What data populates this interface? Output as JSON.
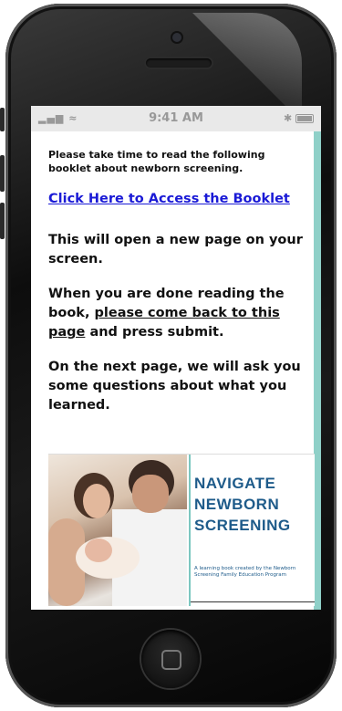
{
  "status_bar": {
    "signal": "▂▄▆",
    "time": "9:41 AM",
    "bluetooth": "✱"
  },
  "page": {
    "intro": "Please take time to read the following booklet about newborn screening.",
    "link_text": "Click Here to Access the Booklet",
    "para1": "This will open a new page on your screen.",
    "para2_prefix": "When you are done reading the book, ",
    "para2_link": "please come back to this page",
    "para2_suffix": " and press submit.",
    "para3": "On the next page, we will ask you some questions about what you learned."
  },
  "booklet_cover": {
    "title_line1": "NAVIGATE",
    "title_line2": "NEWBORN",
    "title_line3": "SCREENING",
    "subtitle": "A learning book created by the Newborn Screening Family Education Program"
  },
  "colors": {
    "link": "#1a1ad6",
    "accent": "#8fd0c8",
    "cover_title": "#1e5b8a"
  }
}
